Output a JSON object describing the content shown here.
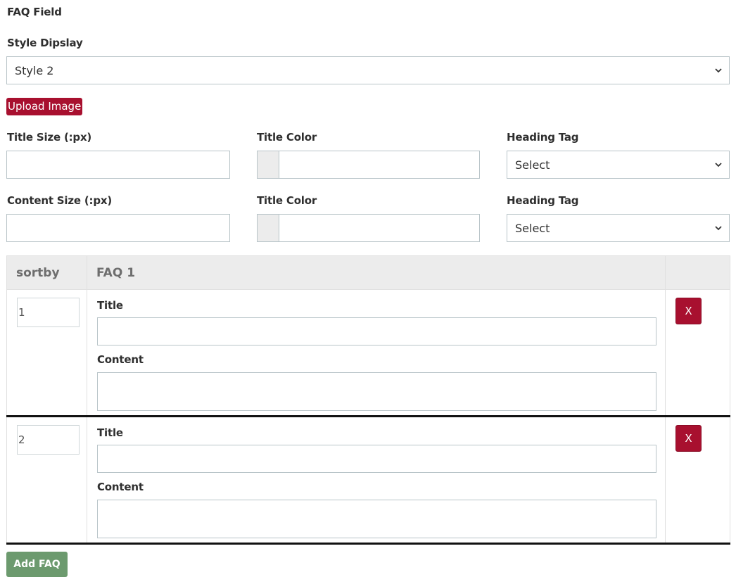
{
  "field": {
    "title": "FAQ Field",
    "style_label": "Style Dipslay",
    "style_value": "Style 2",
    "upload_label": "Upload Image"
  },
  "settings": {
    "row1": {
      "size_label": "Title Size (:px)",
      "color_label": "Title Color",
      "tag_label": "Heading Tag",
      "tag_value": "Select"
    },
    "row2": {
      "size_label": "Content Size (:px)",
      "color_label": "Title Color",
      "tag_label": "Heading Tag",
      "tag_value": "Select"
    }
  },
  "table": {
    "headers": [
      "sortby",
      "FAQ 1",
      ""
    ],
    "rows": [
      {
        "sort": "1",
        "title_label": "Title",
        "content_label": "Content",
        "remove_label": "X"
      },
      {
        "sort": "2",
        "title_label": "Title",
        "content_label": "Content",
        "remove_label": "X"
      }
    ]
  },
  "add_label": "Add FAQ",
  "icons": {
    "select_chevron": "chevron-down-icon"
  },
  "colors": {
    "danger": "#a8102f",
    "success": "#6c9a6e",
    "header_bg": "#ececec"
  }
}
